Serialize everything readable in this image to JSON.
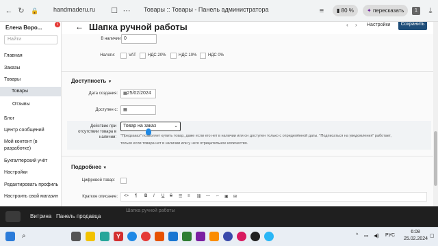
{
  "browser": {
    "url": "handmaderu.ru",
    "tab_title": "Товары :: Товары - Панель администратора",
    "battery": "80 %",
    "retell_label": "пересказать",
    "count_badge": "1"
  },
  "sidebar": {
    "user_name": "Елена Воро...",
    "notification_count": "1",
    "search_placeholder": "Найти",
    "items": [
      {
        "label": "Главная"
      },
      {
        "label": "Заказы"
      },
      {
        "label": "Товары"
      },
      {
        "label": "Товары"
      },
      {
        "label": "Отзывы"
      },
      {
        "label": "Блог"
      },
      {
        "label": "Центр сообщений"
      },
      {
        "label": "Мой контент (в"
      },
      {
        "label": "разработке)"
      },
      {
        "label": "Бухгалтерский учёт"
      },
      {
        "label": "Настройки"
      },
      {
        "label": "Редактировать профиль"
      },
      {
        "label": "Настроить свой магазин"
      }
    ]
  },
  "header": {
    "title": "Шапка ручной работы",
    "settings_label": "Настройки",
    "save_label": "Сохранить"
  },
  "form": {
    "in_stock_label": "В наличии:",
    "in_stock_value": "0",
    "taxes_label": "Налоги:",
    "taxes": [
      "VAT",
      "НДС 20%",
      "НДС 10%",
      "НДС 0%"
    ],
    "availability_title": "Доступность",
    "created_label": "Дата создания:",
    "created_value": "25/02/2024",
    "available_label": "Доступен с:",
    "action_label_1": "Действие при",
    "action_label_2": "отсутствии товара в",
    "action_label_3": "наличии:",
    "action_value": "Товар на заказ",
    "action_hint_1": "\"Предзаказ\" позволяет купить товар, даже если его нет в наличии или он доступен только с определённой даты. \"Подписаться на уведомления\" работает,",
    "action_hint_2": "только если товара нет в наличии или у него отрицательное количество.",
    "details_title": "Подробнее",
    "digital_label": "Цифровой товар:",
    "short_desc_label": "Краткое описание:"
  },
  "notif": {
    "storefront": "Витрина",
    "seller_panel": "Панель продавца",
    "ghost_title": "Шапка ручной работы"
  },
  "taskbar": {
    "lang": "РУС",
    "time": "6:08",
    "date": "25.02.2024"
  }
}
